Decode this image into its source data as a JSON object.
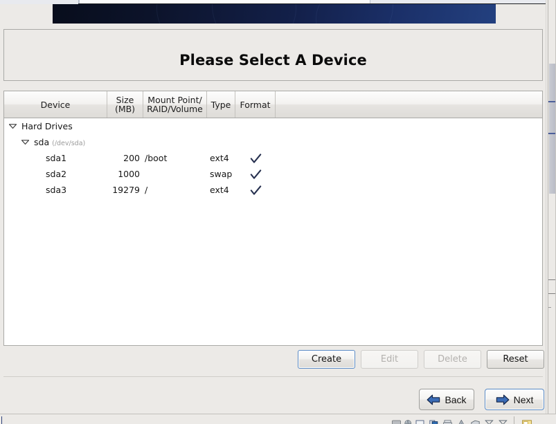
{
  "window": {
    "title": "Please Select A Device",
    "banner_gradient_from": "#080d1c",
    "banner_gradient_to": "#23407f"
  },
  "table": {
    "columns": [
      {
        "id": "device",
        "label": "Device",
        "label_line2": ""
      },
      {
        "id": "size",
        "label": "Size",
        "label_line2": "(MB)"
      },
      {
        "id": "mount",
        "label": "Mount Point/",
        "label_line2": "RAID/Volume"
      },
      {
        "id": "type",
        "label": "Type",
        "label_line2": ""
      },
      {
        "id": "format",
        "label": "Format",
        "label_line2": ""
      },
      {
        "id": "spare",
        "label": "",
        "label_line2": ""
      }
    ],
    "rows": [
      {
        "device": "Hard Drives",
        "detail": "",
        "size": "",
        "mount": "",
        "type": "",
        "format": false,
        "depth": 0,
        "expander": "expanded-triangle-icon"
      },
      {
        "device": "sda",
        "detail": "(/dev/sda)",
        "size": "",
        "mount": "",
        "type": "",
        "format": false,
        "depth": 1,
        "expander": "expanded-triangle-icon"
      },
      {
        "device": "sda1",
        "detail": "",
        "size": "200",
        "mount": "/boot",
        "type": "ext4",
        "format": true,
        "depth": 2,
        "expander": ""
      },
      {
        "device": "sda2",
        "detail": "",
        "size": "1000",
        "mount": "",
        "type": "swap",
        "format": true,
        "depth": 2,
        "expander": ""
      },
      {
        "device": "sda3",
        "detail": "",
        "size": "19279",
        "mount": "/",
        "type": "ext4",
        "format": true,
        "depth": 2,
        "expander": ""
      }
    ],
    "checkmark_color": "#26304f"
  },
  "actions": {
    "create": {
      "label": "Create",
      "enabled": true,
      "focused": true
    },
    "edit": {
      "label": "Edit",
      "enabled": false,
      "focused": false
    },
    "delete": {
      "label": "Delete",
      "enabled": false,
      "focused": false
    },
    "reset": {
      "label": "Reset",
      "enabled": true,
      "focused": false
    }
  },
  "navigation": {
    "back": {
      "label": "Back",
      "icon": "arrow-left-icon",
      "focused": false
    },
    "next": {
      "label": "Next",
      "icon": "arrow-right-icon",
      "focused": true
    },
    "arrow_color": "#3a6bb5"
  },
  "taskbar": {
    "label": ""
  }
}
